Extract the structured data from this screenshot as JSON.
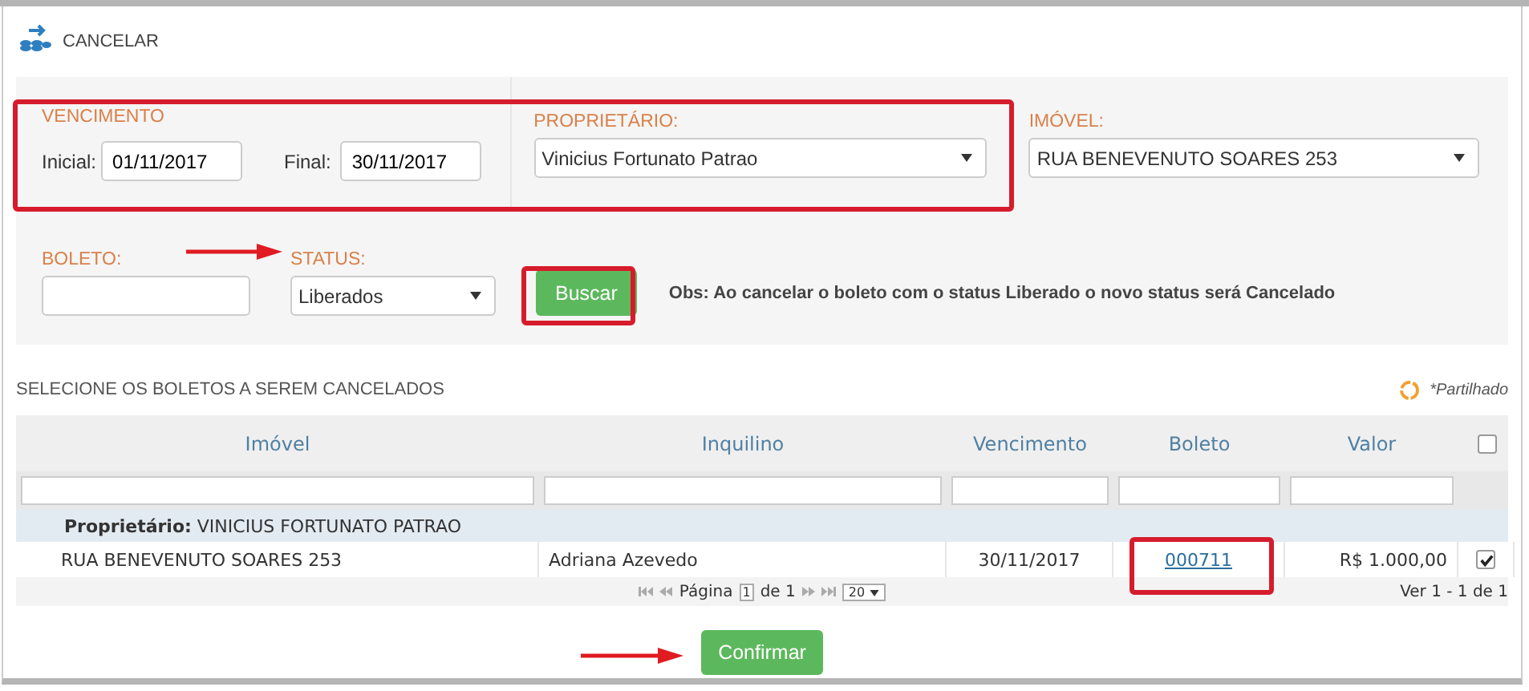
{
  "header": {
    "title": "CANCELAR"
  },
  "filters": {
    "vencimento_label": "VENCIMENTO",
    "inicial_label": "Inicial:",
    "inicial_value": "01/11/2017",
    "final_label": "Final:",
    "final_value": "30/11/2017",
    "proprietario_label": "PROPRIETÁRIO:",
    "proprietario_value": "Vinicius Fortunato Patrao",
    "imovel_label": "IMÓVEL:",
    "imovel_value": "RUA BENEVENUTO SOARES 253",
    "boleto_label": "BOLETO:",
    "status_label": "STATUS:",
    "status_value": "Liberados",
    "search_button": "Buscar",
    "note": "Obs: Ao cancelar o boleto com o status Liberado o novo status será Cancelado"
  },
  "table": {
    "title": "SELECIONE OS BOLETOS A SEREM CANCELADOS",
    "legend": "*Partilhado",
    "columns": [
      "Imóvel",
      "Inquilino",
      "Vencimento",
      "Boleto",
      "Valor"
    ],
    "select_all_checked": false,
    "groups": [
      {
        "label": "**Proprietário:** VINICIUS FORTUNATO PATRAO",
        "rows": [
          {
            "imovel": "RUA BENEVENUTO SOARES 253",
            "inquilino": "Adriana Azevedo",
            "vencimento": "30/11/2017",
            "boleto": "000711",
            "valor": "R$ 1.000,00",
            "checked": true
          }
        ]
      }
    ],
    "pager": {
      "page_label": "Página",
      "page": "1",
      "of_label": "de 1",
      "page_size": "20",
      "summary": "Ver 1 - 1 de 1"
    }
  },
  "confirm_button": "Confirmar"
}
